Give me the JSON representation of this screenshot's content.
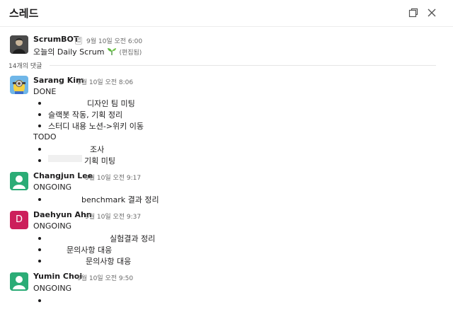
{
  "header": {
    "title": "스레드"
  },
  "parent": {
    "name": "ScrumBOT",
    "app_badge": "앱",
    "time": "9월 10일 오전 6:00",
    "text": "오늘의 Daily Scrum",
    "edited": "(편집됨)"
  },
  "reply_count": "14개의 댓글",
  "replies": [
    {
      "name": "Sarang Kim",
      "time": "9월 10일 오전 8:06",
      "lines": {
        "h1": "DONE",
        "b1": "디자인 팀 미팅",
        "b2": "슬랙봇 작동, 기획 정리",
        "b3": "스터디 내용 노션->위키 이동",
        "h2": "TODO",
        "b4": "조사",
        "b5": "기획 미팅"
      }
    },
    {
      "name": "Changjun Lee",
      "time": "9월 10일 오전 9:17",
      "lines": {
        "h1": "ONGOING",
        "b1": "benchmark 결과 정리"
      }
    },
    {
      "name": "Daehyun Ahn",
      "initial": "D",
      "time": "9월 10일 오전 9:37",
      "lines": {
        "h1": "ONGOING",
        "b1": "실험결과 정리",
        "b2": "문의사항 대응",
        "b3": "문의사항 대응"
      }
    },
    {
      "name": "Yumin Choi",
      "time": "9월 10일 오전 9:50",
      "lines": {
        "h1": "ONGOING"
      }
    }
  ],
  "colors": {
    "avatar_green": "#2bac76",
    "avatar_magenta": "#cc1f5b",
    "text": "#1d1c1d",
    "muted": "#6a6a6a"
  },
  "icons": [
    "open-in-new-window-icon",
    "close-icon",
    "sprout-emoji-icon",
    "default-user-avatar-icon"
  ]
}
